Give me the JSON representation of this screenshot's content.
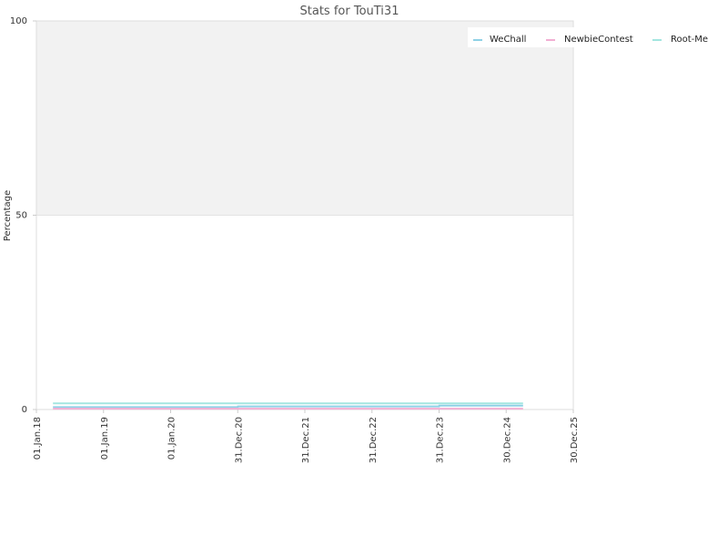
{
  "chart_data": {
    "type": "line",
    "title": "Stats for TouTi31",
    "xlabel": "",
    "ylabel": "Percentage",
    "ylim": [
      0,
      100
    ],
    "y_ticks": [
      "0",
      "50",
      "100"
    ],
    "x_ticks": [
      "01.Jan.18",
      "01.Jan.19",
      "01.Jan.20",
      "31.Dec.20",
      "31.Dec.21",
      "31.Dec.22",
      "31.Dec.23",
      "30.Dec.24",
      "30.Dec.25"
    ],
    "x_tick_dates": [
      "2018-01-01",
      "2019-01-01",
      "2020-01-01",
      "2020-12-31",
      "2021-12-31",
      "2022-12-31",
      "2023-12-31",
      "2024-12-30",
      "2025-12-30"
    ],
    "xlim": [
      "2018-01-01",
      "2025-12-30"
    ],
    "shaded_band": [
      50,
      100
    ],
    "legend_position": "top-right",
    "grid": false,
    "series": [
      {
        "name": "WeChall",
        "color": "#8fd1e6",
        "points": [
          {
            "x": "2018-04-01",
            "y": 0.6
          },
          {
            "x": "2020-12-31",
            "y": 0.6
          },
          {
            "x": "2021-01-01",
            "y": 0.8
          },
          {
            "x": "2023-12-31",
            "y": 0.8
          },
          {
            "x": "2024-01-01",
            "y": 1.0
          },
          {
            "x": "2025-04-01",
            "y": 1.0
          }
        ]
      },
      {
        "name": "NewbieContest",
        "color": "#f2afd3",
        "points": [
          {
            "x": "2018-04-01",
            "y": 0.2
          },
          {
            "x": "2025-04-01",
            "y": 0.2
          }
        ]
      },
      {
        "name": "Root-Me",
        "color": "#a3e6e0",
        "points": [
          {
            "x": "2018-04-01",
            "y": 1.6
          },
          {
            "x": "2025-04-01",
            "y": 1.6
          }
        ]
      }
    ]
  }
}
